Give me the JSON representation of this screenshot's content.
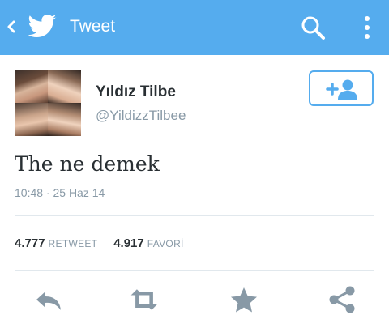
{
  "appbar": {
    "title": "Tweet",
    "back_icon": "chevron-left-icon",
    "logo_icon": "twitter-bird-icon",
    "search_icon": "search-icon",
    "overflow_icon": "more-vertical-icon",
    "color": "#55acee"
  },
  "tweet": {
    "author_name": "Yıldız Tilbe",
    "author_handle": "@YildizzTilbee",
    "text": "The ne demek",
    "timestamp": "10:48 · 25 Haz 14",
    "retweet_count": "4.777",
    "retweet_label": "RETWEET",
    "favorite_count": "4.917",
    "favorite_label": "FAVORİ"
  },
  "follow_button": {
    "icon": "add-user-icon"
  },
  "actions": [
    "reply-icon",
    "retweet-icon",
    "favorite-star-icon",
    "share-icon"
  ]
}
